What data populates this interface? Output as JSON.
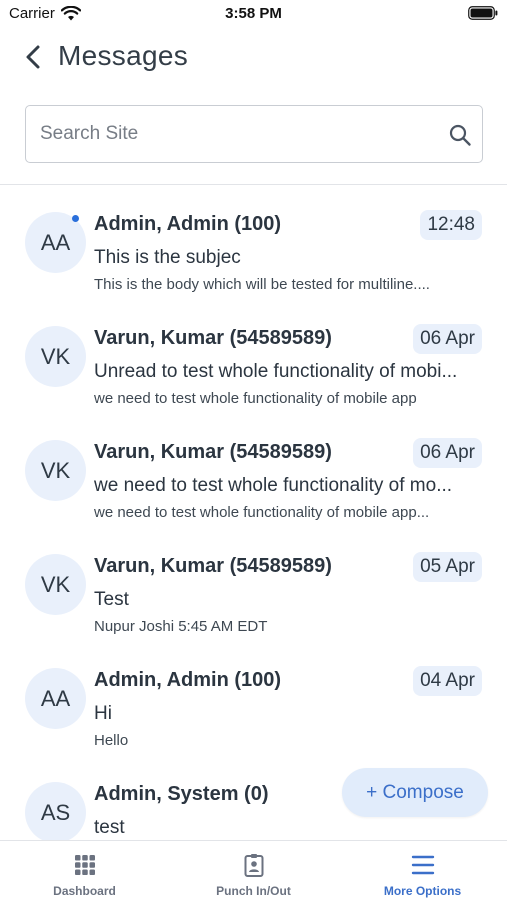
{
  "status_bar": {
    "carrier": "Carrier",
    "time": "3:58 PM"
  },
  "header": {
    "title": "Messages"
  },
  "search": {
    "placeholder": "Search Site",
    "value": ""
  },
  "messages": [
    {
      "initials": "AA",
      "unread": true,
      "sender": "Admin, Admin (100)",
      "date": "12:48",
      "subject": "This is the subjec",
      "preview": "This is the body which will be tested for multiline...."
    },
    {
      "initials": "VK",
      "unread": false,
      "sender": "Varun, Kumar (54589589)",
      "date": "06 Apr",
      "subject": "Unread to test whole functionality of mobi...",
      "preview": "we need to test whole functionality of mobile app"
    },
    {
      "initials": "VK",
      "unread": false,
      "sender": "Varun, Kumar (54589589)",
      "date": "06 Apr",
      "subject": "we need to test whole functionality of mo...",
      "preview": "we need to test whole functionality of mobile app..."
    },
    {
      "initials": "VK",
      "unread": false,
      "sender": "Varun, Kumar (54589589)",
      "date": "05 Apr",
      "subject": "Test",
      "preview": "Nupur Joshi 5:45 AM EDT"
    },
    {
      "initials": "AA",
      "unread": false,
      "sender": "Admin, Admin (100)",
      "date": "04 Apr",
      "subject": "Hi",
      "preview": "Hello"
    },
    {
      "initials": "AS",
      "unread": false,
      "sender": "Admin, System (0)",
      "date": "",
      "subject": "test",
      "preview": ""
    }
  ],
  "compose": {
    "label": "+ Compose"
  },
  "tabbar": {
    "tabs": [
      {
        "label": "Dashboard",
        "icon": "grid-icon",
        "active": false
      },
      {
        "label": "Punch In/Out",
        "icon": "badge-icon",
        "active": false
      },
      {
        "label": "More Options",
        "icon": "menu-icon",
        "active": true
      }
    ]
  },
  "colors": {
    "accent": "#3b6fc9",
    "unread_dot": "#2a6fdb",
    "avatar_bg": "#e9f0fb"
  }
}
